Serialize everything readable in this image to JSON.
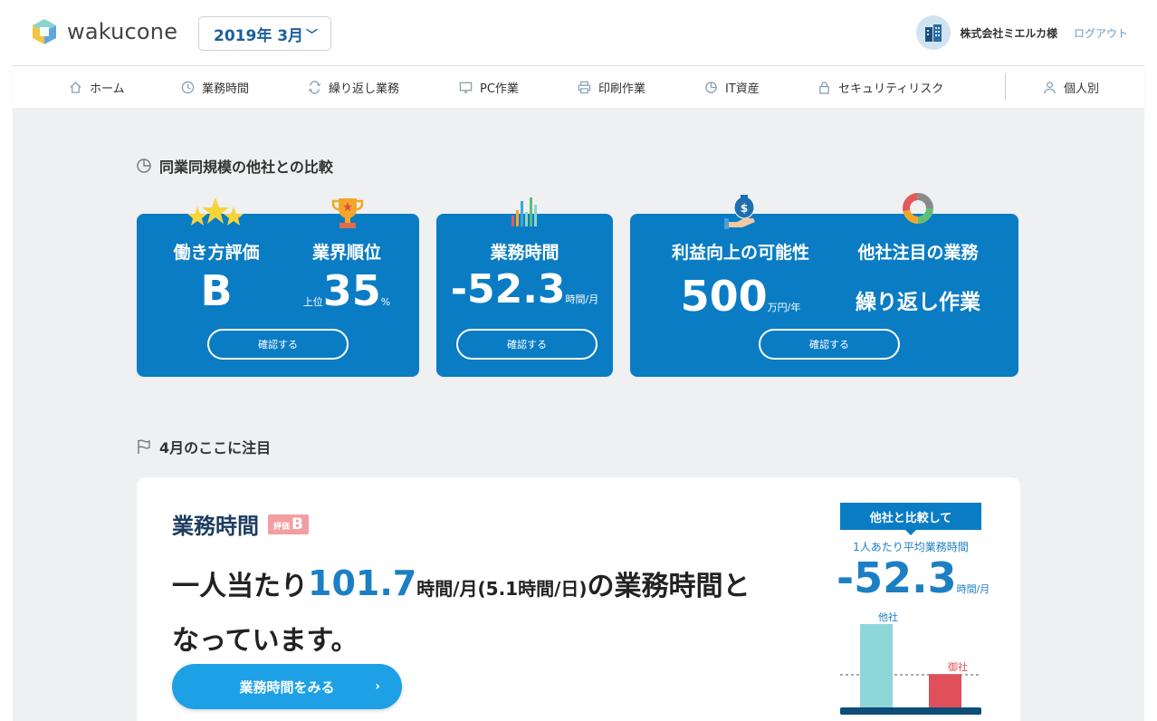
{
  "header": {
    "logo_text": "wakucone",
    "month": "2019年 3月",
    "company": "株式会社ミエルカ様",
    "logout": "ログアウト"
  },
  "nav": {
    "items": [
      {
        "label": "ホーム",
        "icon": "home-icon"
      },
      {
        "label": "業務時間",
        "icon": "clock-icon"
      },
      {
        "label": "繰り返し業務",
        "icon": "repeat-icon"
      },
      {
        "label": "PC作業",
        "icon": "monitor-icon"
      },
      {
        "label": "印刷作業",
        "icon": "printer-icon"
      },
      {
        "label": "IT資産",
        "icon": "pie-icon"
      },
      {
        "label": "セキュリティリスク",
        "icon": "lock-icon"
      },
      {
        "label": "個人別",
        "icon": "person-icon"
      }
    ]
  },
  "comparison": {
    "title": "同業同規模の他社との比較",
    "cards": {
      "workstyle_label": "働き方評価",
      "workstyle_value": "B",
      "rank_label": "業界順位",
      "rank_prefix": "上位",
      "rank_value": "35",
      "rank_unit": "%",
      "hours_label": "業務時間",
      "hours_value": "-52.3",
      "hours_unit": "時間/月",
      "profit_label": "利益向上の可能性",
      "profit_value": "500",
      "profit_unit": "万円/年",
      "focus_label": "他社注目の業務",
      "focus_value": "繰り返し作業",
      "confirm": "確認する"
    }
  },
  "focus": {
    "section_title": "4月のここに注目",
    "title": "業務時間",
    "grade_prefix": "評価",
    "grade": "B",
    "text_pre": "一人当たり",
    "text_value": "101.7",
    "text_mid": "時間/月(5.1時間/日)",
    "text_post": "の業務時間と",
    "text_line2": "なっています。",
    "cta": "業務時間をみる",
    "compare_head": "他社と比較して",
    "compare_sub": "1人あたり平均業務時間",
    "compare_value": "-52.3",
    "compare_unit": "時間/月",
    "bar_other": "他社",
    "bar_ours": "御社",
    "bar_other_level": 1.0,
    "bar_ours_level": 0.4,
    "colors": {
      "other": "#8fd6d8",
      "ours": "#e0505a",
      "accent": "#0a7cc4"
    }
  }
}
